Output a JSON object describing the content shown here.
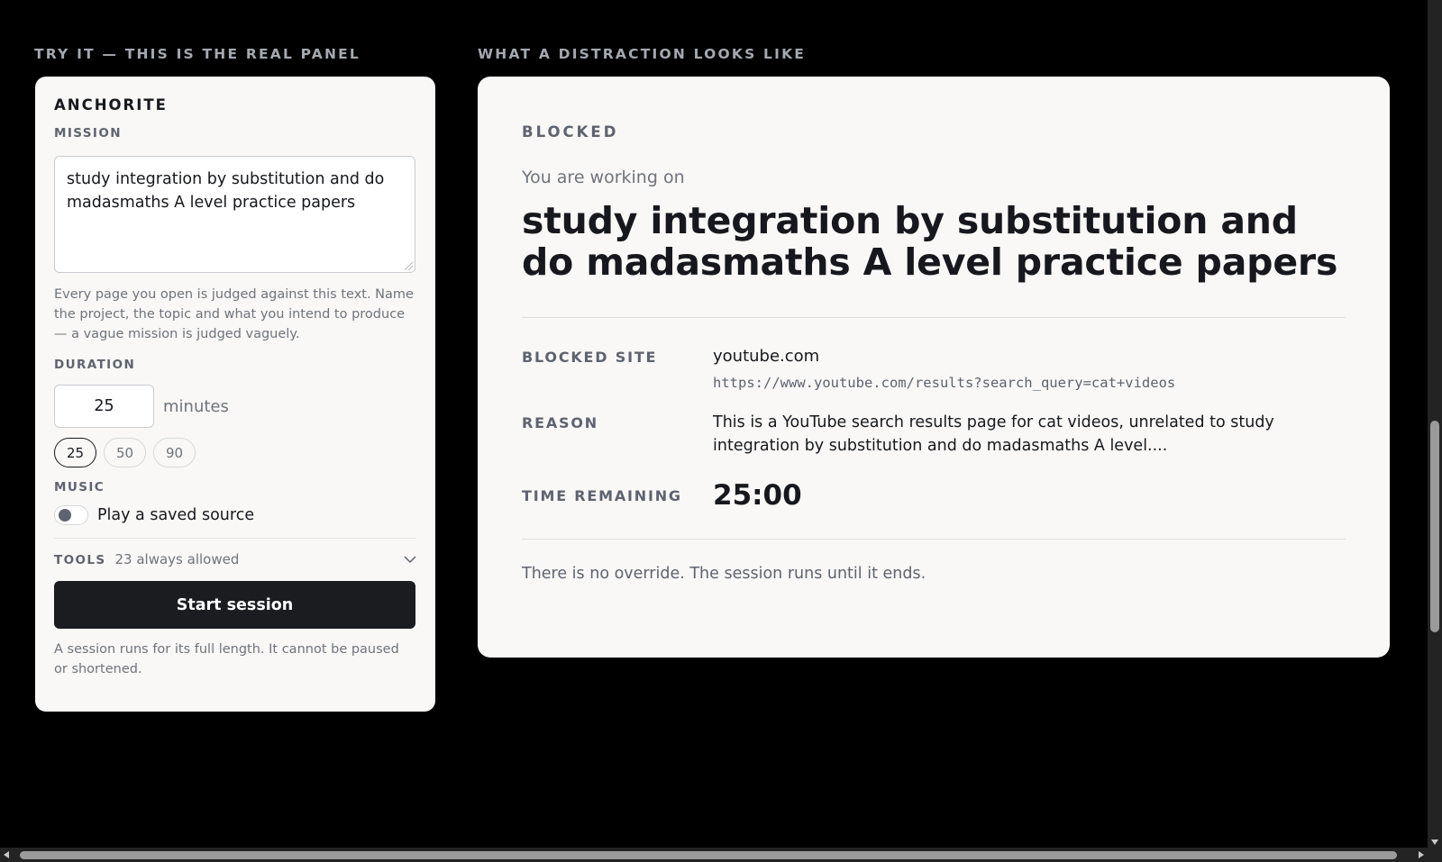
{
  "left_section_label": "TRY IT — THIS IS THE REAL PANEL",
  "right_section_label": "WHAT A DISTRACTION LOOKS LIKE",
  "panel": {
    "brand": "ANCHORITE",
    "mission_label": "MISSION",
    "mission_value": "study integration by substitution and do madasmaths A level practice papers",
    "mission_hint": "Every page you open is judged against this text. Name the project, the topic and what you intend to produce — a vague mission is judged vaguely.",
    "duration_label": "DURATION",
    "duration_value": "25",
    "duration_unit": "minutes",
    "presets": [
      "25",
      "50",
      "90"
    ],
    "active_preset": "25",
    "music_label": "MUSIC",
    "music_toggle_label": "Play a saved source",
    "music_on": false,
    "tools_label": "TOOLS",
    "tools_count": "23 always allowed",
    "start_label": "Start session",
    "footnote": "A session runs for its full length. It cannot be paused or shortened."
  },
  "blocked_card": {
    "tag": "BLOCKED",
    "working_on_label": "You are working on",
    "mission_title": "study integration by substitution and do madasmaths A level practice papers",
    "site_label": "BLOCKED SITE",
    "site_name": "youtube.com",
    "site_url": "https://www.youtube.com/results?search_query=cat+videos",
    "reason_label": "REASON",
    "reason_text": "This is a YouTube search results page for cat videos, unrelated to study integration by substitution and do madasmaths A level....",
    "time_label": "TIME REMAINING",
    "time_value": "25:00",
    "no_override": "There is no override. The session runs until it ends."
  },
  "colors": {
    "background": "#000000",
    "panel_background": "#f9f8f6",
    "primary_button": "#1a1c20",
    "muted_text": "#6f737c"
  }
}
